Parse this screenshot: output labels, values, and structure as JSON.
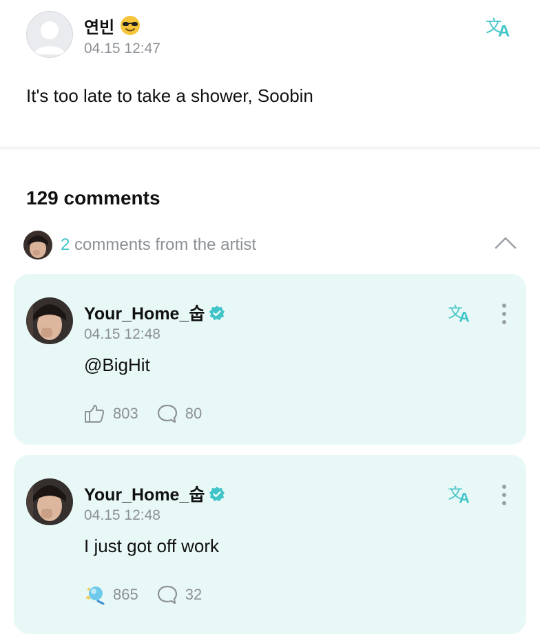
{
  "post": {
    "author": "연빈",
    "author_emoji": "sunglasses-emoji",
    "timestamp": "04.15 12:47",
    "text": "It's too late to take a shower, Soobin"
  },
  "comments_header": "129 comments",
  "artist_row": {
    "count": "2",
    "label": "comments from the artist"
  },
  "comments": [
    {
      "name": "Your_Home_숩",
      "timestamp": "04.15 12:48",
      "text": "@BigHit",
      "likes": "803",
      "replies": "80"
    },
    {
      "name": "Your_Home_숩",
      "timestamp": "04.15 12:48",
      "text": "I just got off work",
      "likes": "865",
      "replies": "32"
    }
  ],
  "colors": {
    "accent": "#40c4c8",
    "card_bg": "#e8f8f6",
    "muted_text": "#8c9196"
  },
  "icons": [
    "default-avatar-icon",
    "sunglasses-emoji-icon",
    "translate-icon",
    "chevron-up-icon",
    "verified-badge-icon",
    "more-options-icon",
    "like-icon",
    "reply-icon"
  ]
}
